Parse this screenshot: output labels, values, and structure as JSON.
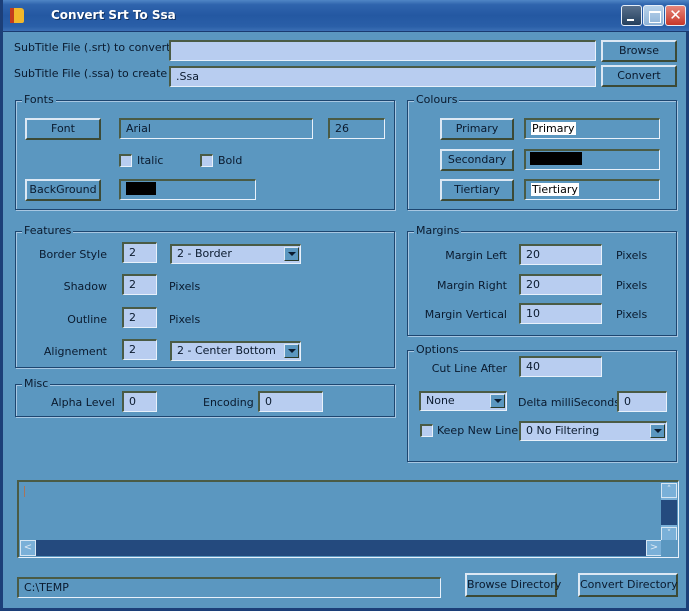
{
  "window": {
    "title": "Convert Srt To Ssa",
    "close_glyph": "✕"
  },
  "files": {
    "srt_label": "SubTitle File (.srt) to convert",
    "srt_value": "",
    "ssa_label": "SubTitle File (.ssa) to create",
    "ssa_value": ".Ssa",
    "browse_label": "Browse",
    "convert_label": "Convert"
  },
  "fonts": {
    "title": "Fonts",
    "font_button": "Font",
    "font_name": "Arial",
    "font_size": "26",
    "italic_label": "Italic",
    "italic_checked": false,
    "bold_label": "Bold",
    "bold_checked": false,
    "background_button": "BackGround",
    "background_color": "#000000"
  },
  "colours": {
    "title": "Colours",
    "primary_button": "Primary",
    "primary_value": "Primary",
    "secondary_button": "Secondary",
    "secondary_color": "#000000",
    "tertiary_button": "Tiertiary",
    "tertiary_value": "Tiertiary"
  },
  "features": {
    "title": "Features",
    "border_style_label": "Border Style",
    "border_style_value": "2",
    "border_style_select": "2 - Border",
    "shadow_label": "Shadow",
    "shadow_value": "2",
    "shadow_unit": "Pixels",
    "outline_label": "Outline",
    "outline_value": "2",
    "outline_unit": "Pixels",
    "alignment_label": "Alignement",
    "alignment_value": "2",
    "alignment_select": "2 - Center Bottom"
  },
  "margins": {
    "title": "Margins",
    "left_label": "Margin Left",
    "left_value": "20",
    "right_label": "Margin Right",
    "right_value": "20",
    "vertical_label": "Margin Vertical",
    "vertical_value": "10",
    "unit": "Pixels"
  },
  "misc": {
    "title": "Misc",
    "alpha_label": "Alpha Level",
    "alpha_value": "0",
    "encoding_label": "Encoding",
    "encoding_value": "0"
  },
  "options": {
    "title": "Options",
    "cut_line_label": "Cut Line After",
    "cut_line_value": "40",
    "mode_select": "None",
    "delta_label": "Delta milliSeconds",
    "delta_value": "0",
    "keep_new_line_label": "Keep New Line",
    "keep_new_line_checked": false,
    "filter_select": "0 No Filtering"
  },
  "log": {
    "content": "",
    "scroll_up": "˄",
    "scroll_down": "˅",
    "scroll_left": "<",
    "scroll_right": ">"
  },
  "directory": {
    "path": "C:\\TEMP",
    "browse_directory_label": "Browse Directory",
    "convert_directory_label": "Convert Directory"
  }
}
